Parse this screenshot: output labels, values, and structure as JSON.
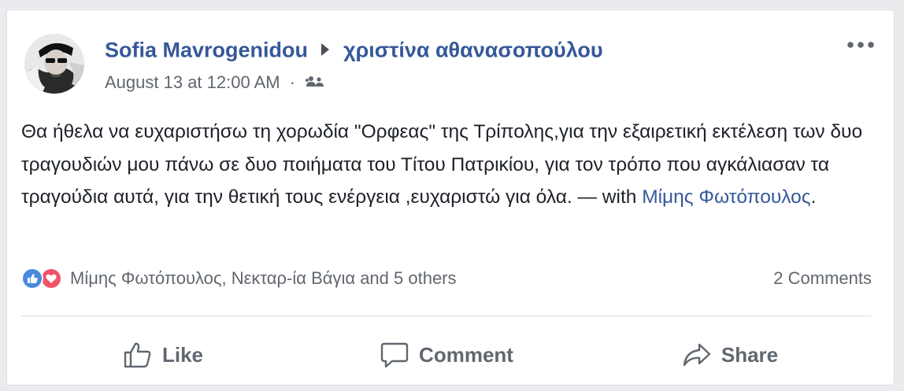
{
  "post": {
    "author": "Sofia Mavrogenidou",
    "recipient": "χριστίνα αθανασοπούλου",
    "timestamp": "August 13 at 12:00 AM",
    "separator": "·",
    "audience_icon": "friends-icon",
    "more_icon": "more-dots-icon",
    "body_text": "Θα ήθελα να ευχαριστήσω τη χορωδία \"Ορφεας\" της Τρίπολης,για την εξαιρετική εκτέλεση των δυο τραγουδιών μου πάνω σε δυο ποιήματα του Τίτου Πατρικίου, για τον τρόπο που αγκάλιασαν τα τραγούδια αυτά, για την θετική τους ενέργεια ,ευχαριστώ για όλα.",
    "with_prefix": " — with ",
    "tagged_person": "Μίμης Φωτόπουλος",
    "with_suffix": "."
  },
  "reactions": {
    "icons": [
      "like-reaction-icon",
      "love-reaction-icon"
    ],
    "summary": "Μίμης Φωτόπουλος, Νεκταρ-ία Βάγια and 5 others",
    "comments": "2 Comments"
  },
  "actions": {
    "like": "Like",
    "comment": "Comment",
    "share": "Share"
  },
  "colors": {
    "link": "#365899",
    "meta": "#616770",
    "like_blue": "#4a89dc",
    "love_red": "#f25268",
    "background": "#e9ebee"
  }
}
